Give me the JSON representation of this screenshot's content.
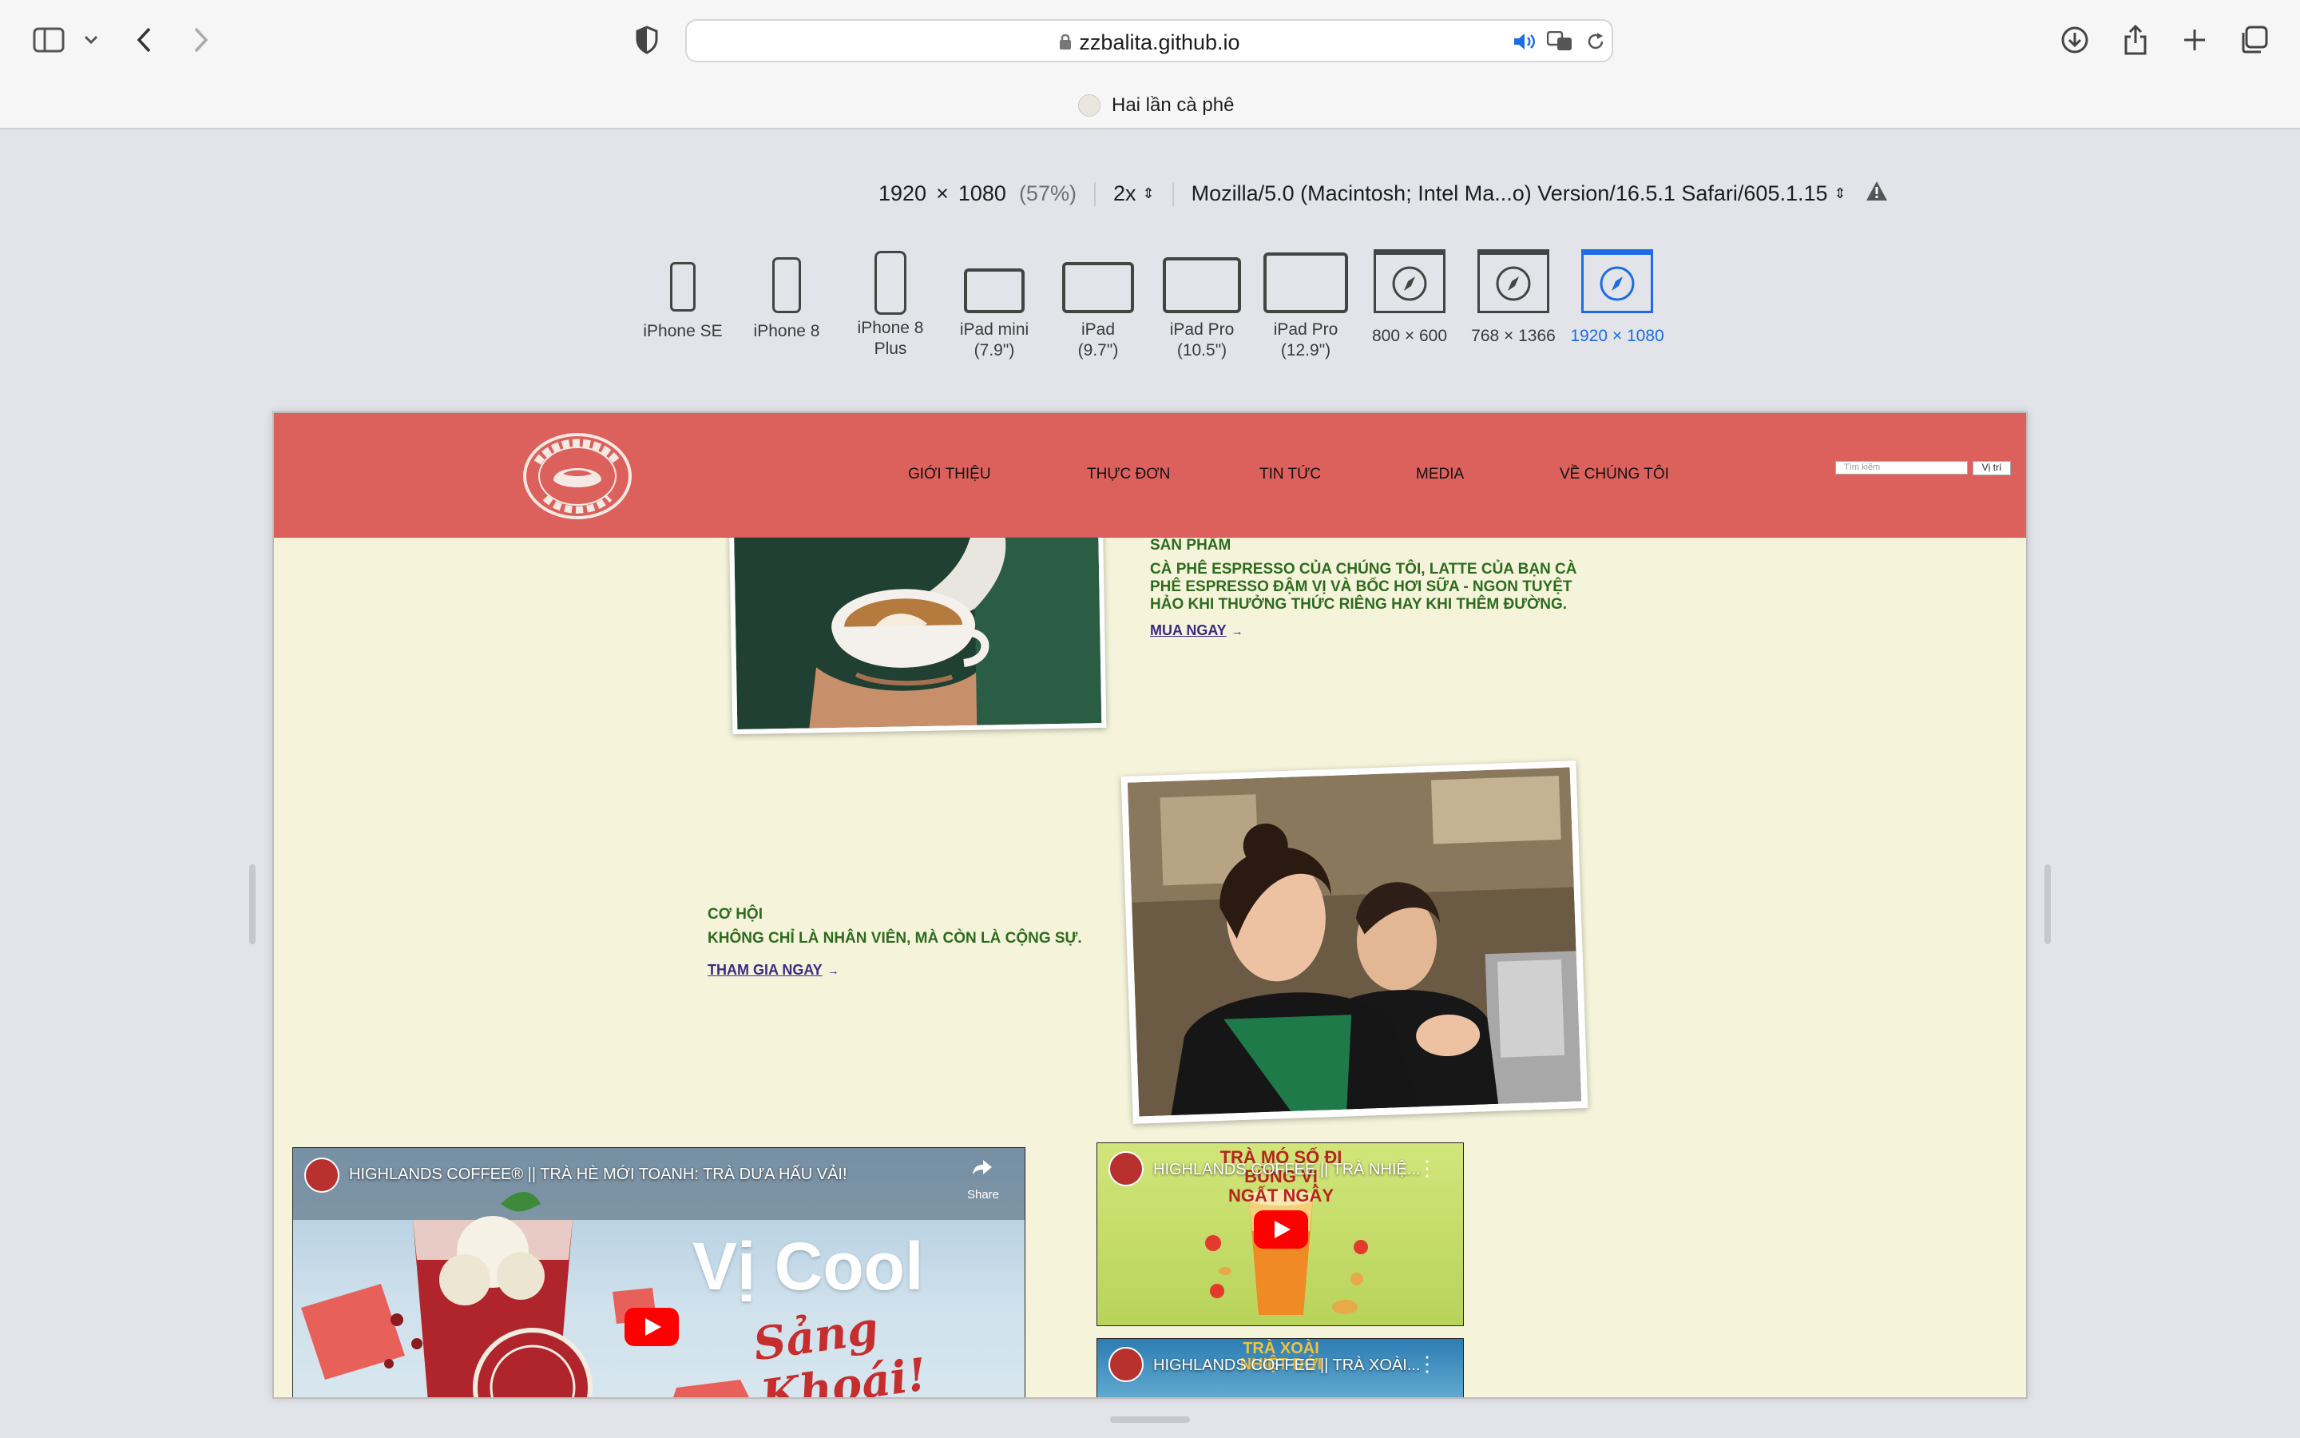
{
  "browser": {
    "url": "zzbalita.github.io",
    "tab_title": "Hai lần cà phê"
  },
  "responsive_bar": {
    "width": "1920",
    "times": "×",
    "height": "1080",
    "zoom": "(57%)",
    "scale": "2x",
    "user_agent": "Mozilla/5.0 (Macintosh; Intel Ma...o) Version/16.5.1 Safari/605.1.15"
  },
  "devices": [
    {
      "label": "iPhone SE"
    },
    {
      "label": "iPhone 8"
    },
    {
      "label": "iPhone 8 Plus"
    },
    {
      "label": "iPad mini (7.9\")"
    },
    {
      "label": "iPad (9.7\")"
    },
    {
      "label": "iPad Pro (10.5\")"
    },
    {
      "label": "iPad Pro (12.9\")"
    },
    {
      "label": "800 × 600"
    },
    {
      "label": "768 × 1366"
    },
    {
      "label": "1920 × 1080",
      "selected": true
    }
  ],
  "site": {
    "nav": [
      "GIỚI THIỆU",
      "THỰC ĐƠN",
      "TIN TỨC",
      "MEDIA",
      "VỀ CHÚNG TÔI"
    ],
    "search_placeholder": "Tìm kiếm",
    "search_button": "Vị trí",
    "product": {
      "heading": "SẢN PHẨM",
      "body": "CÀ PHÊ ESPRESSO CỦA CHÚNG TÔI, LATTE CỦA BẠN CÀ PHÊ ESPRESSO ĐẬM VỊ VÀ BỐC HƠI SỮA - NGON TUYỆT HẢO KHI THƯỞNG THỨC RIÊNG HAY KHI THÊM ĐƯỜNG.",
      "link": "MUA NGAY"
    },
    "career": {
      "heading": "CƠ HỘI",
      "body": "KHÔNG CHỈ LÀ NHÂN VIÊN, MÀ CÒN LÀ CỘNG SỰ.",
      "link": "THAM GIA NGAY"
    },
    "videos": [
      {
        "title": "HIGHLANDS COFFEE® || TRÀ HÈ MỚI TOANH: TRÀ DƯA HẤU VẢI!",
        "share": "Share",
        "overlay_1": "Vị Cool",
        "overlay_2": "Sảng Khoái!"
      },
      {
        "title": "HIGHLANDS COFFEE || TRÀ NHIỆ...",
        "overlay": "TRÀ MÓ SỐ ĐI BÙNG VỊ NGẤT NGÂY"
      },
      {
        "title": "HIGHLANDS COFFEE || TRÀ XOÀI...",
        "overlay": "TRÀ XOÀI NHIỆT ĐỚI"
      }
    ]
  },
  "colors": {
    "header_red": "#dc615c",
    "page_cream": "#f5f4db",
    "text_green": "#2d6b1e",
    "link_purple": "#3a2a84",
    "selected_blue": "#1b6ce5"
  }
}
